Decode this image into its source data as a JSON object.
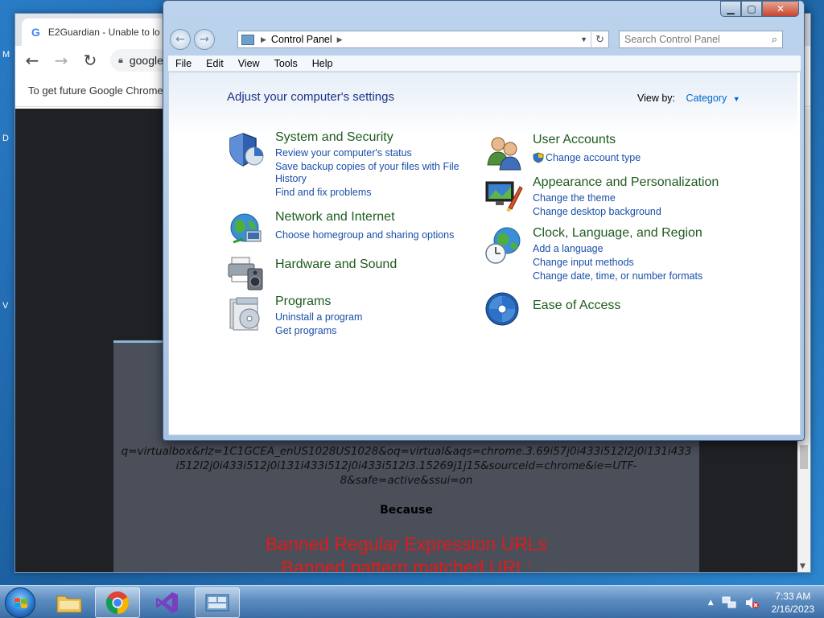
{
  "desktop": {
    "edge_letters": [
      "M",
      "D",
      "V"
    ]
  },
  "chrome": {
    "tab_title": "E2Guardian - Unable to lo",
    "omnibox_text": "google",
    "info_bar": "To get future Google Chrome",
    "e2guardian": {
      "url_lines": [
        "q=virtualbox&rlz=1C1GCEA_enUS1028US1028&oq=virtual&aqs=chrome.3.69i57j0i433i512l2j0i131i433",
        "i512l2j0i433i512j0i131i433i512j0i433i512l3.15269j1j15&sourceid=chrome&ie=UTF-",
        "8&safe=active&ssui=on"
      ],
      "because": "Because",
      "reason_line1": "Banned Regular Expression URLs",
      "reason_line2": "Banned pattern matched URL:"
    }
  },
  "control_panel": {
    "address": "Control Panel",
    "search_placeholder": "Search Control Panel",
    "menu": [
      "File",
      "Edit",
      "View",
      "Tools",
      "Help"
    ],
    "heading": "Adjust your computer's settings",
    "view_by_label": "View by:",
    "view_by_value": "Category",
    "left": [
      {
        "title": "System and Security",
        "icon": "shield-icon",
        "links": [
          "Review your computer's status",
          "Save backup copies of your files with File",
          "History",
          "Find and fix problems"
        ]
      },
      {
        "title": "Network and Internet",
        "icon": "globe-network-icon",
        "links": [
          "Choose homegroup and sharing options"
        ]
      },
      {
        "title": "Hardware and Sound",
        "icon": "printer-speaker-icon",
        "links": []
      },
      {
        "title": "Programs",
        "icon": "programs-disc-icon",
        "links": [
          "Uninstall a program",
          "Get programs"
        ]
      }
    ],
    "right": [
      {
        "title": "User Accounts",
        "icon": "users-icon",
        "links": [
          "Change account type"
        ]
      },
      {
        "title": "Appearance and Personalization",
        "icon": "monitor-brush-icon",
        "links": [
          "Change the theme",
          "Change desktop background"
        ]
      },
      {
        "title": "Clock, Language, and Region",
        "icon": "clock-globe-icon",
        "links": [
          "Add a language",
          "Change input methods",
          "Change date, time, or number formats"
        ]
      },
      {
        "title": "Ease of Access",
        "icon": "ease-of-access-icon",
        "links": []
      }
    ]
  },
  "taskbar": {
    "apps": [
      "explorer-folder-icon",
      "chrome-icon",
      "visual-studio-icon",
      "control-panel-icon"
    ],
    "time": "7:33 AM",
    "date": "2/16/2023"
  },
  "colors": {
    "category_title": "#1e5b1e",
    "link": "#1a4fa8",
    "heading": "#1e3287",
    "banned_text": "#e01b1b"
  }
}
